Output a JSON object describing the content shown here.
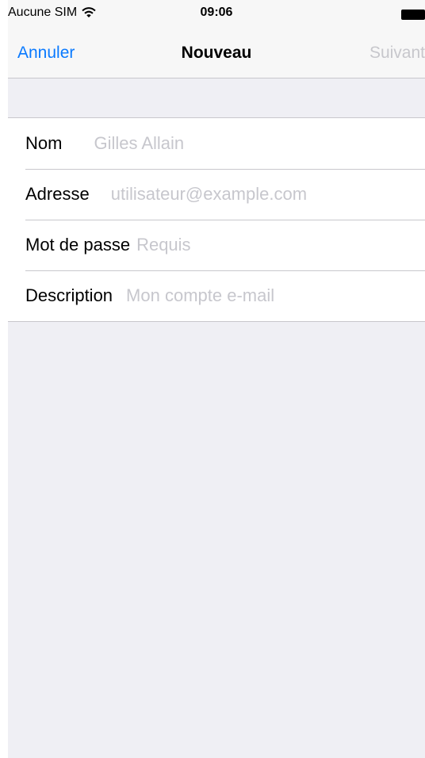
{
  "status_bar": {
    "carrier": "Aucune SIM",
    "time": "09:06"
  },
  "nav_bar": {
    "cancel_label": "Annuler",
    "title": "Nouveau",
    "next_label": "Suivant"
  },
  "form": {
    "fields": [
      {
        "label": "Nom",
        "value": "",
        "placeholder": "Gilles Allain"
      },
      {
        "label": "Adresse",
        "value": "",
        "placeholder": "utilisateur@example.com"
      },
      {
        "label": "Mot de passe",
        "value": "",
        "placeholder": "Requis"
      },
      {
        "label": "Description",
        "value": "",
        "placeholder": "Mon compte e-mail"
      }
    ]
  },
  "colors": {
    "accent": "#0a7aff",
    "disabled": "#c7c7cc",
    "background": "#efeff4",
    "separator": "#c8c7cc"
  },
  "icons": {
    "wifi": "wifi-icon",
    "battery": "battery-icon"
  }
}
